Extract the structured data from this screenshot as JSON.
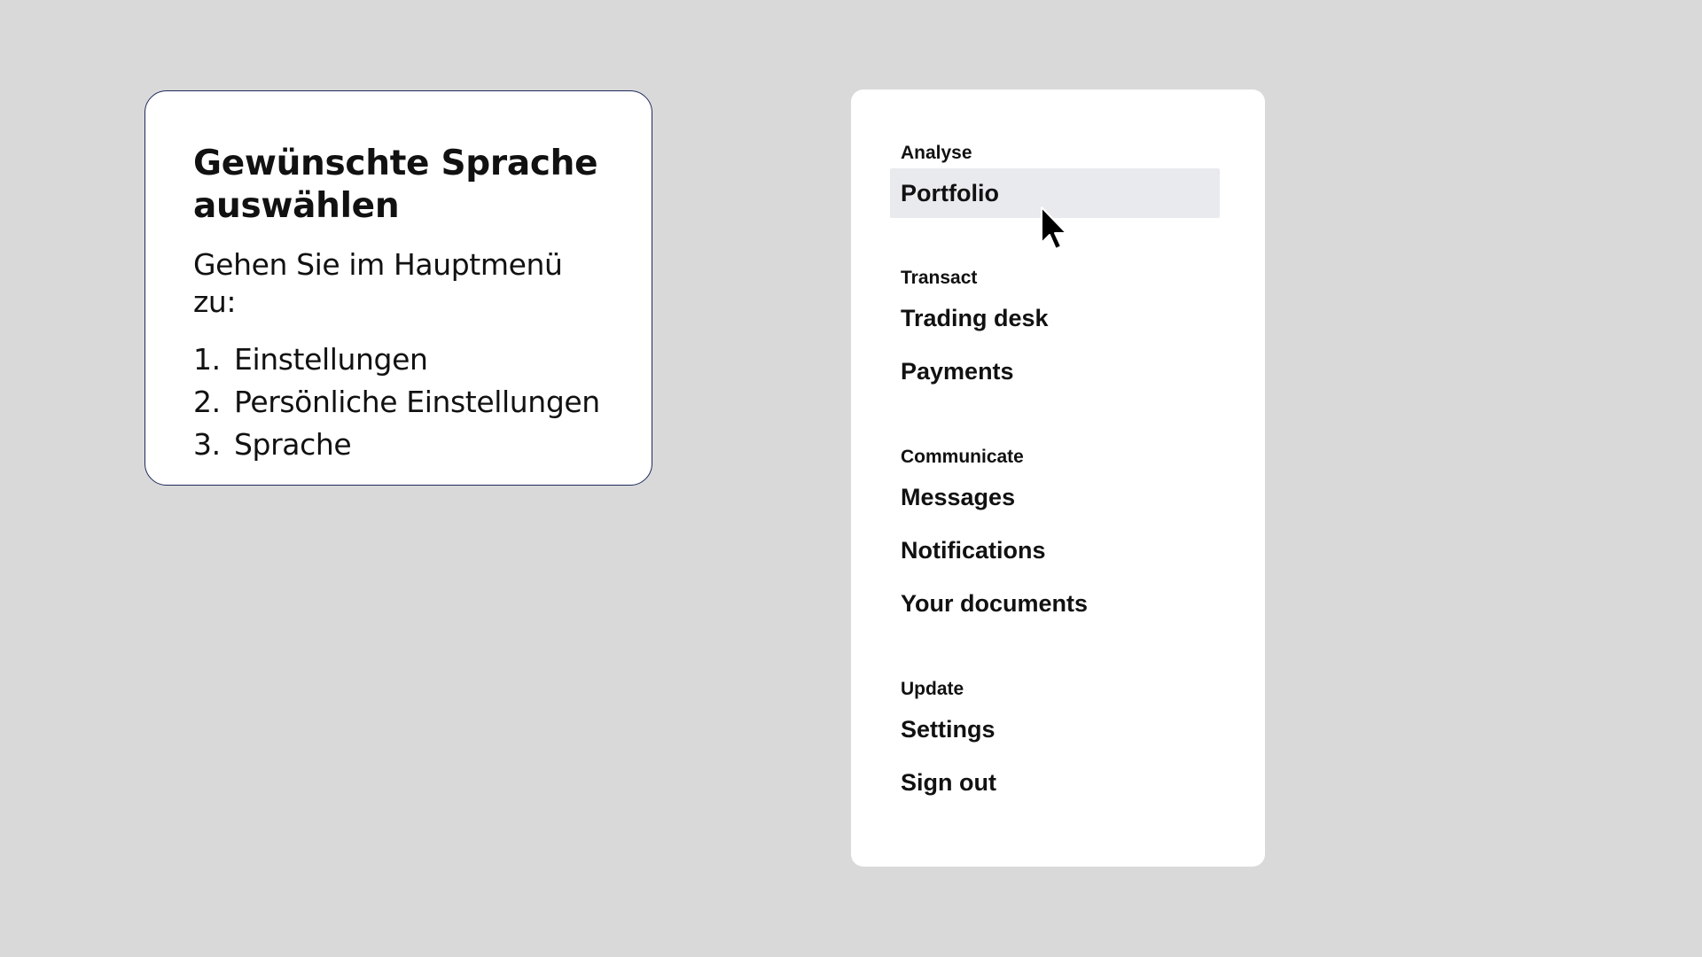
{
  "instructions": {
    "title": "Gewünschte Sprache auswählen",
    "lead": "Gehen Sie im Hauptmenü zu:",
    "steps": [
      {
        "num": "1.",
        "label": "Einstellungen"
      },
      {
        "num": "2.",
        "label": "Persönliche Einstellungen"
      },
      {
        "num": "3.",
        "label": "Sprache"
      }
    ]
  },
  "menu": {
    "groups": [
      {
        "label": "Analyse",
        "items": [
          {
            "label": "Portfolio",
            "active": true
          }
        ]
      },
      {
        "label": "Transact",
        "items": [
          {
            "label": "Trading desk"
          },
          {
            "label": "Payments"
          }
        ]
      },
      {
        "label": "Communicate",
        "items": [
          {
            "label": "Messages"
          },
          {
            "label": "Notifications"
          },
          {
            "label": "Your documents"
          }
        ]
      },
      {
        "label": "Update",
        "items": [
          {
            "label": "Settings"
          },
          {
            "label": "Sign out"
          }
        ]
      }
    ]
  },
  "icons": {
    "cursor": "mouse-pointer-icon"
  },
  "colors": {
    "background": "#d9d9d9",
    "card": "#ffffff",
    "card_border": "#1f2b5c",
    "active_item": "#e9eaee",
    "text": "#111111"
  }
}
